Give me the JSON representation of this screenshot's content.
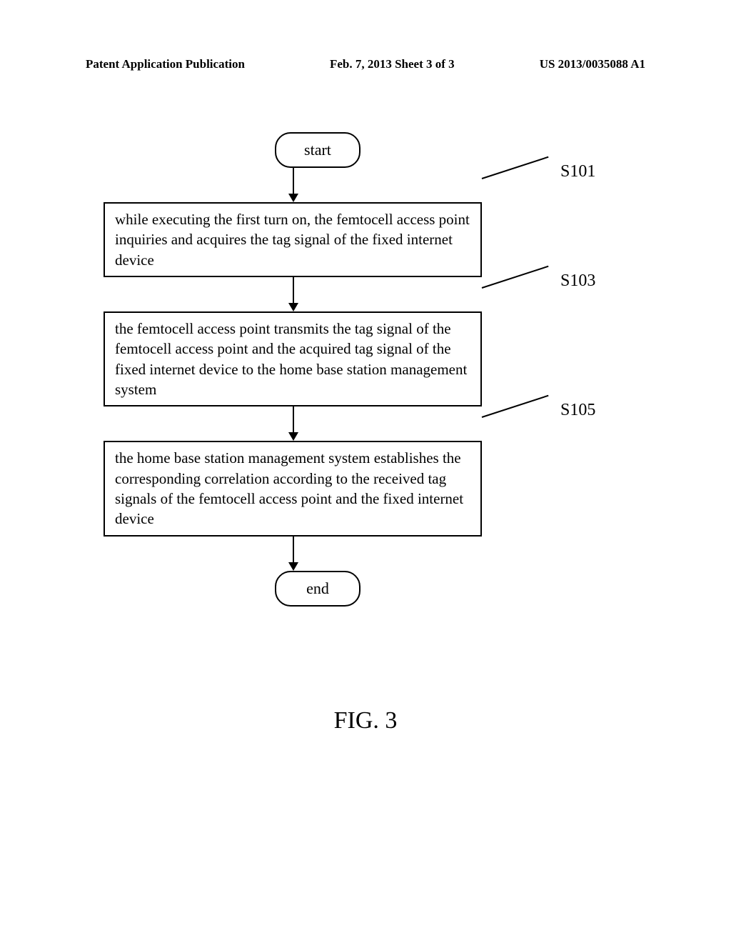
{
  "header": {
    "left": "Patent Application Publication",
    "center": "Feb. 7, 2013   Sheet 3 of 3",
    "right": "US 2013/0035088 A1"
  },
  "flowchart": {
    "start": "start",
    "end": "end",
    "steps": [
      {
        "label": "S101",
        "text": "while executing the first turn on, the femtocell access point inquiries and acquires the tag signal of the fixed internet device"
      },
      {
        "label": "S103",
        "text": "the femtocell access point transmits the tag signal of the femtocell access point and the acquired tag signal of the fixed internet device to the home base station management system"
      },
      {
        "label": "S105",
        "text": "the home base station management system establishes the corresponding correlation according to the received tag signals of the femtocell access point and the fixed internet device"
      }
    ]
  },
  "figure": "FIG. 3"
}
